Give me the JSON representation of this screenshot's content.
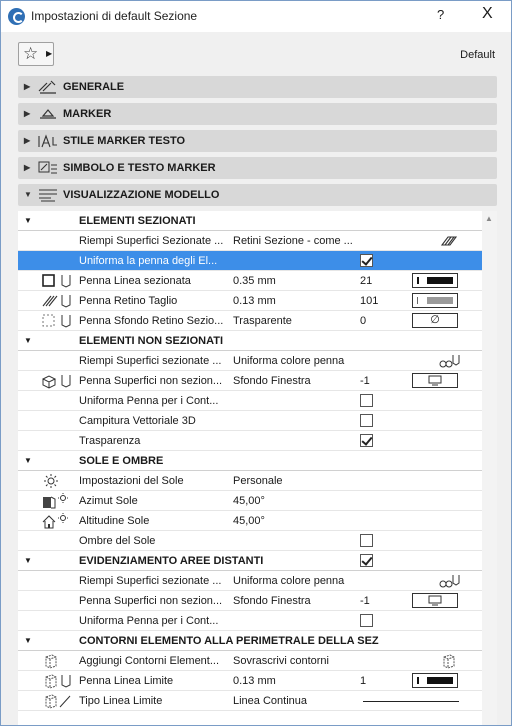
{
  "window": {
    "title": "Impostazioni di default Sezione",
    "help_label": "?",
    "close_label": "X"
  },
  "toolbar": {
    "default_label": "Default"
  },
  "sections": [
    {
      "label": "GENERALE",
      "icon": "generale-icon"
    },
    {
      "label": "MARKER",
      "icon": "marker-icon"
    },
    {
      "label": "STILE MARKER TESTO",
      "icon": "stile-marker-testo-icon"
    },
    {
      "label": "SIMBOLO E TESTO MARKER",
      "icon": "simbolo-testo-marker-icon"
    },
    {
      "label": "VISUALIZZAZIONE MODELLO",
      "icon": "visualizzazione-modello-icon"
    }
  ],
  "groups": {
    "elementi_sezionati": "ELEMENTI SEZIONATI",
    "elementi_non_sezionati": "ELEMENTI NON SEZIONATI",
    "sole_ombre": "SOLE E OMBRE",
    "evidenziamento": "EVIDENZIAMENTO AREE DISTANTI",
    "contorni": "CONTORNI ELEMENTO ALLA PERIMETRALE DELLA SEZIONE"
  },
  "rows": {
    "r1": {
      "name": "Riempi Superfici Sezionate ...",
      "value": "Retini Sezione - come ..."
    },
    "r2": {
      "name": "Uniforma la penna degli El...",
      "checked": true
    },
    "r3": {
      "name": "Penna Linea sezionata",
      "value": "0.35 mm",
      "num": "21"
    },
    "r4": {
      "name": "Penna Retino Taglio",
      "value": "0.13 mm",
      "num": "101"
    },
    "r5": {
      "name": "Penna Sfondo Retino Sezio...",
      "value": "Trasparente",
      "num": "0",
      "swatch_symbol": "∅"
    },
    "r6": {
      "name": "Riempi Superfici sezionate ...",
      "value": "Uniforma colore penna"
    },
    "r7": {
      "name": "Penna Superfici non sezion...",
      "value": "Sfondo Finestra",
      "num": "-1"
    },
    "r8": {
      "name": "Uniforma Penna per i Cont...",
      "checked": false
    },
    "r9": {
      "name": "Campitura Vettoriale 3D",
      "checked": false
    },
    "r10": {
      "name": "Trasparenza",
      "checked": true
    },
    "r11": {
      "name": "Impostazioni del Sole",
      "value": "Personale"
    },
    "r12": {
      "name": "Azimut Sole",
      "value": "45,00°"
    },
    "r13": {
      "name": "Altitudine Sole",
      "value": "45,00°"
    },
    "r14": {
      "name": "Ombre del Sole",
      "checked": false
    },
    "r15": {
      "name": "Riempi Superfici sezionate ...",
      "value": "Uniforma colore penna"
    },
    "r16": {
      "name": "Penna Superfici non sezion...",
      "value": "Sfondo Finestra",
      "num": "-1"
    },
    "r17": {
      "name": "Uniforma Penna per i Cont...",
      "checked": false
    },
    "r18": {
      "name": "Aggiungi Contorni Element...",
      "value": "Sovrascrivi contorni"
    },
    "r19": {
      "name": "Penna Linea Limite",
      "value": "0.13 mm",
      "num": "1"
    },
    "r20": {
      "name": "Tipo Linea Limite",
      "value": "Linea Continua"
    }
  },
  "evidenziamento_checked": true,
  "colors": {
    "selection": "#3d8ee8",
    "section_bg": "#d8d8d8",
    "accent": "#2f6fb5"
  }
}
